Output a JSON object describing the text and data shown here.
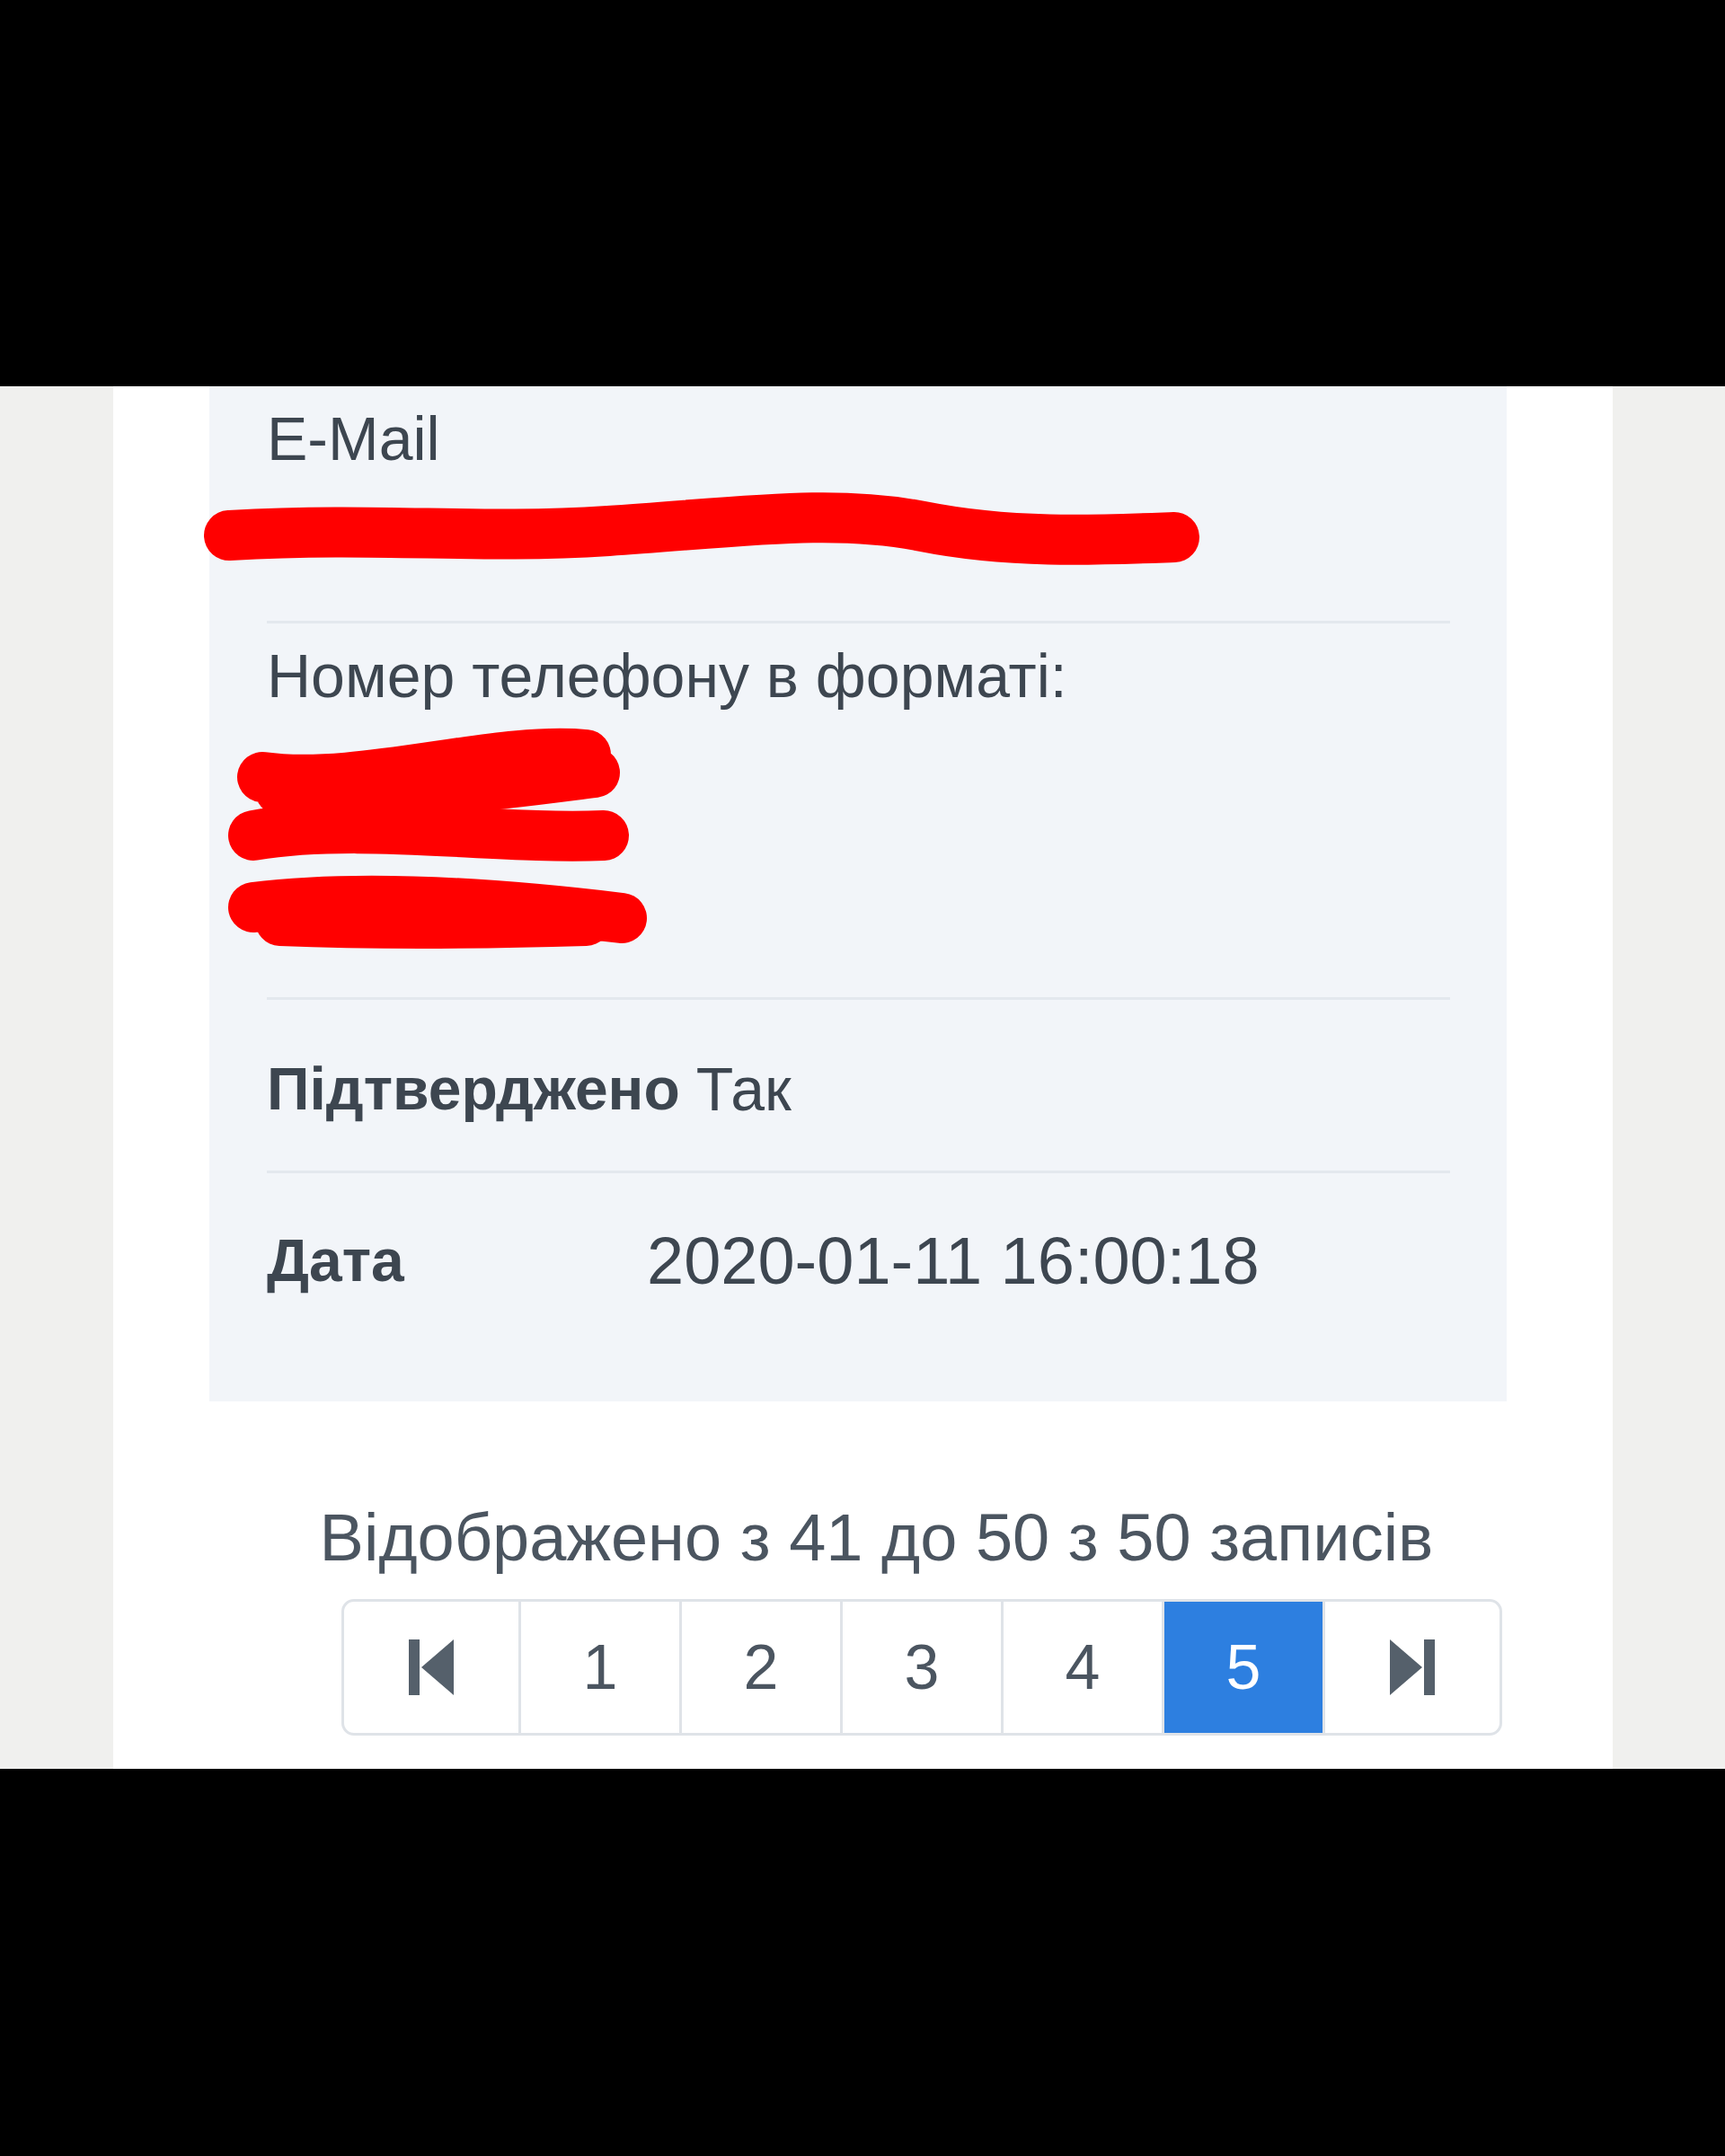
{
  "fields": [
    {
      "kind": "redacted-line",
      "label": "E-Mail"
    },
    {
      "kind": "redacted-lines",
      "label": "Номер телефону в форматі:"
    },
    {
      "kind": "inline",
      "label": "Підтверджено",
      "value": "Так"
    },
    {
      "kind": "column",
      "label": "Дата",
      "value": "2020-01-11 16:00:18"
    }
  ],
  "summary": "Відображено з 41 до 50 з 50 записів",
  "pagination": [
    {
      "kind": "first",
      "selected": false
    },
    {
      "kind": "page",
      "label": "1",
      "selected": false
    },
    {
      "kind": "page",
      "label": "2",
      "selected": false
    },
    {
      "kind": "page",
      "label": "3",
      "selected": false
    },
    {
      "kind": "page",
      "label": "4",
      "selected": false
    },
    {
      "kind": "page",
      "label": "5",
      "selected": true
    },
    {
      "kind": "last",
      "selected": false
    }
  ]
}
